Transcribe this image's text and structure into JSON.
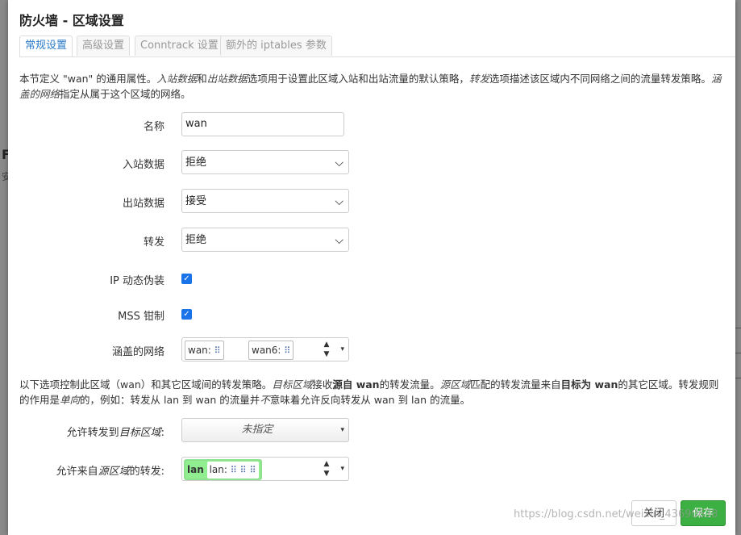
{
  "background": {
    "glyph_f": "F",
    "glyph_dim": "安"
  },
  "dialog": {
    "title": "防火墙 - 区域设置",
    "tabs": [
      "常规设置",
      "高级设置",
      "Conntrack 设置",
      "额外的 iptables 参数"
    ],
    "active_tab": 0,
    "desc_parts": [
      "本节定义 \"wan\" 的通用属性。",
      "入站数据",
      "和",
      "出站数据",
      "选项用于设置此区域入站和出站流量的默认策略，",
      "转发",
      "选项描述该区域内不同网络之间的流量转发策略。",
      "涵盖的网络",
      "指定从属于这个区域的网络。"
    ],
    "fields": {
      "name_label": "名称",
      "name_value": "wan",
      "input_label": "入站数据",
      "input_value": "拒绝",
      "output_label": "出站数据",
      "output_value": "接受",
      "forward_label": "转发",
      "forward_value": "拒绝",
      "masq_label": "IP 动态伪装",
      "masq_checked": true,
      "mss_label": "MSS 钳制",
      "mss_checked": true,
      "covered_label": "涵盖的网络",
      "covered_chips": [
        "wan:",
        "wan6:"
      ]
    },
    "desc2_parts": [
      "以下选项控制此区域（wan）和其它区域间的转发策略。",
      "目标区域",
      "接收",
      "源自 wan",
      "的转发流量。",
      "源区域",
      "匹配的转发流量来自",
      "目标为 wan",
      "的其它区域。转发规则的作用是",
      "单向",
      "的，例如：转发从 lan 到 wan 的流量并",
      "不",
      "意味着允许反向转发从 wan 到 lan 的流量。"
    ],
    "forward_to_label_a": "允许转发到",
    "forward_to_label_b": "目标区域",
    "forward_to_label_c": ":",
    "forward_to_value": "未指定",
    "forward_from_label_a": "允许来自",
    "forward_from_label_b": "源区域",
    "forward_from_label_c": "的转发:",
    "forward_from_zone": "lan",
    "forward_from_net": "lan:",
    "buttons": {
      "close": "关闭",
      "save": "保存"
    },
    "watermark": "https://blog.csdn.net/weixin_43690638"
  },
  "icons": {
    "check": "✓",
    "chevron": "⌵",
    "up": "▲",
    "down": "▼",
    "caret": "▾",
    "net": "⠿"
  }
}
